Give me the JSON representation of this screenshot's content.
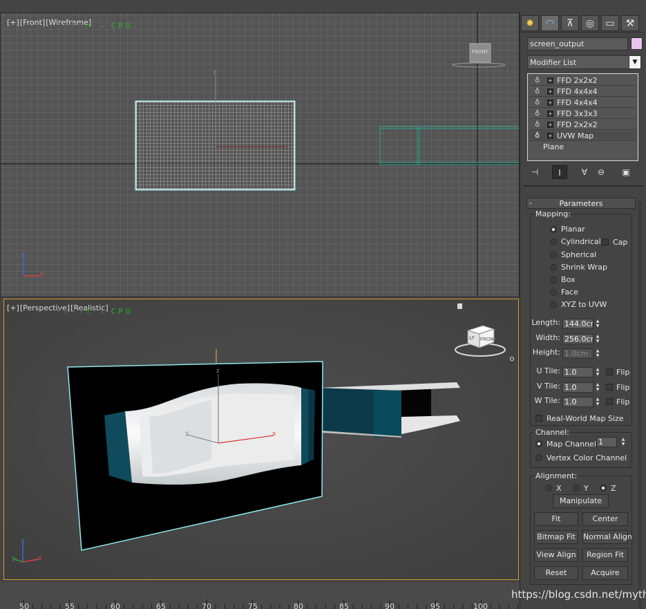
{
  "front_viewport": {
    "labels": [
      "[+]",
      "[Front]",
      "[Wireframe]"
    ],
    "physx_parts": [
      "PHYS",
      "X",
      "•",
      "CPU"
    ],
    "view_cube_label": "FRONT"
  },
  "persp_viewport": {
    "labels": [
      "[+]",
      "[Perspective]",
      "[Realistic]"
    ],
    "physx_parts": [
      "PHYS",
      "X",
      "•",
      "CPU"
    ],
    "view_cube_labels": [
      "LF",
      "FRONT"
    ],
    "gizmo_axes": [
      "x",
      "y",
      "z"
    ]
  },
  "panel": {
    "tabs": [
      {
        "name": "create-tab",
        "glyph": "✹"
      },
      {
        "name": "modify-tab",
        "glyph": "◠"
      },
      {
        "name": "hierarchy-tab",
        "glyph": "⊼"
      },
      {
        "name": "motion-tab",
        "glyph": "◎"
      },
      {
        "name": "display-tab",
        "glyph": "▭"
      },
      {
        "name": "utilities-tab",
        "glyph": "⚒"
      }
    ],
    "object_name": "screen_output",
    "swatch_color": "#e8c4ee",
    "modifier_list_label": "Modifier List",
    "stack": [
      {
        "label": "FFD 2x2x2"
      },
      {
        "label": "FFD 4x4x4"
      },
      {
        "label": "FFD 4x4x4"
      },
      {
        "label": "FFD 3x3x3"
      },
      {
        "label": "FFD 2x2x2"
      },
      {
        "label": "UVW Map"
      }
    ],
    "base_object": "Plane",
    "rollout_title": "Parameters",
    "rollout_minus": "-",
    "mapping": {
      "title": "Mapping:",
      "options": [
        "Planar",
        "Cylindrical",
        "Spherical",
        "Shrink Wrap",
        "Box",
        "Face",
        "XYZ to UVW"
      ],
      "selected_index": 0,
      "cap_label": "Cap",
      "length_label": "Length:",
      "length_value": "144.0cm",
      "width_label": "Width:",
      "width_value": "256.0cm",
      "height_label": "Height:",
      "height_value": "1.0cm",
      "utile_label": "U Tile:",
      "utile_value": "1.0",
      "vtile_label": "V Tile:",
      "vtile_value": "1.0",
      "wtile_label": "W Tile:",
      "wtile_value": "1.0",
      "flip_label": "Flip",
      "realworld_label": "Real-World Map Size"
    },
    "channel": {
      "title": "Channel:",
      "map_channel_label": "Map Channel:",
      "map_channel_value": "1",
      "vertex_color_label": "Vertex Color Channel"
    },
    "alignment": {
      "title": "Alignment:",
      "axes": [
        "X",
        "Y",
        "Z"
      ],
      "selected_axis": 2,
      "manipulate": "Manipulate",
      "fit": "Fit",
      "center": "Center",
      "bitmap_fit": "Bitmap Fit",
      "normal_align": "Normal Align",
      "view_align": "View Align",
      "region_fit": "Region Fit",
      "reset": "Reset",
      "acquire": "Acquire"
    }
  },
  "timeline": {
    "ticks": [
      "50",
      "55",
      "60",
      "65",
      "70",
      "75",
      "80",
      "85",
      "90",
      "95",
      "100"
    ]
  },
  "watermark": "https://blog.csdn.net/myth"
}
